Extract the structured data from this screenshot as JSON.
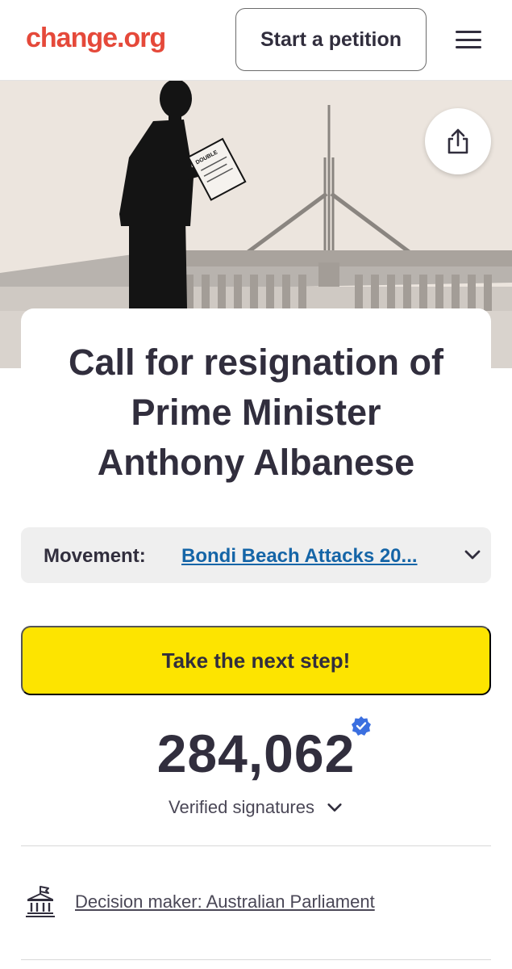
{
  "header": {
    "logo": "change.org",
    "start_petition": "Start a petition"
  },
  "hero": {
    "paper_text": "DOUBLE"
  },
  "petition": {
    "title_lines": [
      "Call for resignation of",
      "Prime Minister",
      "Anthony Albanese"
    ]
  },
  "movement": {
    "label": "Movement:",
    "link": "Bondi Beach Attacks 20..."
  },
  "cta": {
    "next_step": "Take the next step!"
  },
  "signatures": {
    "count": "284,062",
    "label": "Verified signatures"
  },
  "decision_maker": {
    "text": "Decision maker: Australian Parliament"
  },
  "colors": {
    "brand_red": "#e5493a",
    "cta_yellow": "#fde400",
    "link_blue": "#1565a7",
    "verified_blue": "#3b6fe0",
    "text_dark": "#312e3d"
  }
}
